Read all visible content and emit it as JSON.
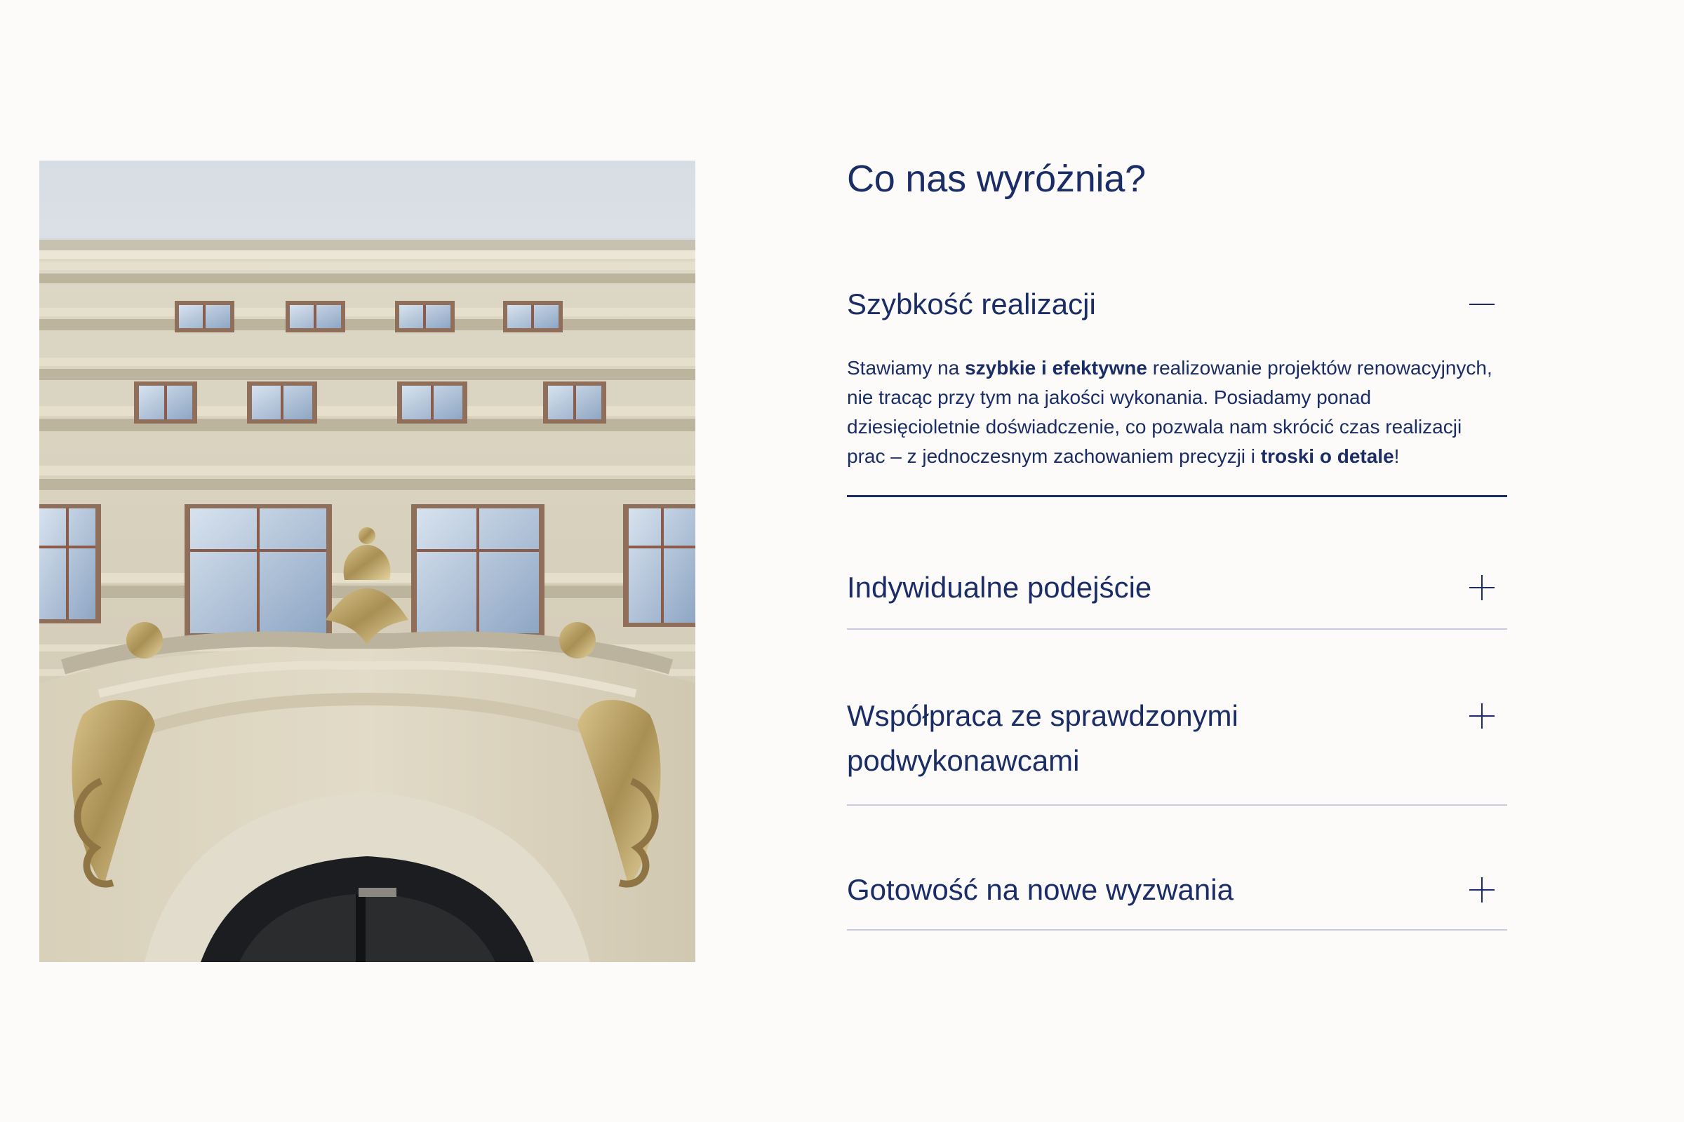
{
  "section": {
    "title": "Co nas wyróżnia?"
  },
  "photo": {
    "alt": "Facade of a restored historic tenement building"
  },
  "accordion": {
    "items": [
      {
        "title": "Szybkość realizacji",
        "expanded": true,
        "toggle_icon": "minus-icon",
        "body": {
          "part1": "Stawiamy na ",
          "strong1": "szybkie i efektywne",
          "part2": " realizowanie projektów renowacyjnych, nie tracąc przy tym na jakości wykonania. Posiadamy ponad dziesięcioletnie doświadczenie, co pozwala nam skrócić czas realizacji prac – z jednoczesnym zachowaniem precyzji i ",
          "strong2": "troski o detale",
          "part3": "!"
        }
      },
      {
        "title": "Indywidualne podejście",
        "expanded": false,
        "toggle_icon": "plus-icon"
      },
      {
        "title": "Współpraca ze sprawdzonymi podwykonawcami",
        "expanded": false,
        "toggle_icon": "plus-icon"
      },
      {
        "title": "Gotowość na nowe wyzwania",
        "expanded": false,
        "toggle_icon": "plus-icon"
      }
    ]
  },
  "colors": {
    "background": "#fcfbf9",
    "accent": "#1b2d66",
    "divider_light": "#c8cbe0"
  }
}
